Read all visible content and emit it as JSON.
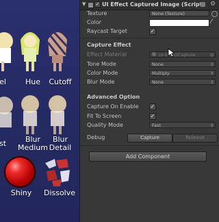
{
  "scene": {
    "labels": {
      "row1_left": "el",
      "hue": "Hue",
      "cutoff": "Cutoff",
      "row2_left": "st",
      "blur_medium": "Blur\nMedium",
      "blur_detail": "Blur\nDetail",
      "shiny": "Shiny",
      "dissolve": "Dissolve"
    }
  },
  "inspector": {
    "component_title": "UI Effect Captured Image (Script)",
    "fields": {
      "texture_label": "Texture",
      "texture_value": "None (Texture)",
      "color_label": "Color",
      "raycast_label": "Raycast Target"
    },
    "capture_effect": {
      "title": "Capture Effect",
      "effect_material_label": "Effect Material",
      "effect_material_value": "UI-EffectCapture",
      "tone_mode_label": "Tone Mode",
      "tone_mode_value": "None",
      "color_mode_label": "Color Mode",
      "color_mode_value": "Multiply",
      "blur_mode_label": "Blur Mode",
      "blur_mode_value": "None"
    },
    "advanced_option": {
      "title": "Advanced Option",
      "capture_on_enable_label": "Capture On Enable",
      "fit_to_screen_label": "Fit To Screen",
      "quality_mode_label": "Quality Mode",
      "quality_mode_value": "Fast"
    },
    "debug": {
      "label": "Debug",
      "capture_button": "Capture",
      "release_button": "Release"
    },
    "add_component": "Add Component"
  },
  "colors": {
    "scene_bg": "#2a2f6e",
    "inspector_bg": "#383838",
    "shiny": "#ee2b2b"
  }
}
